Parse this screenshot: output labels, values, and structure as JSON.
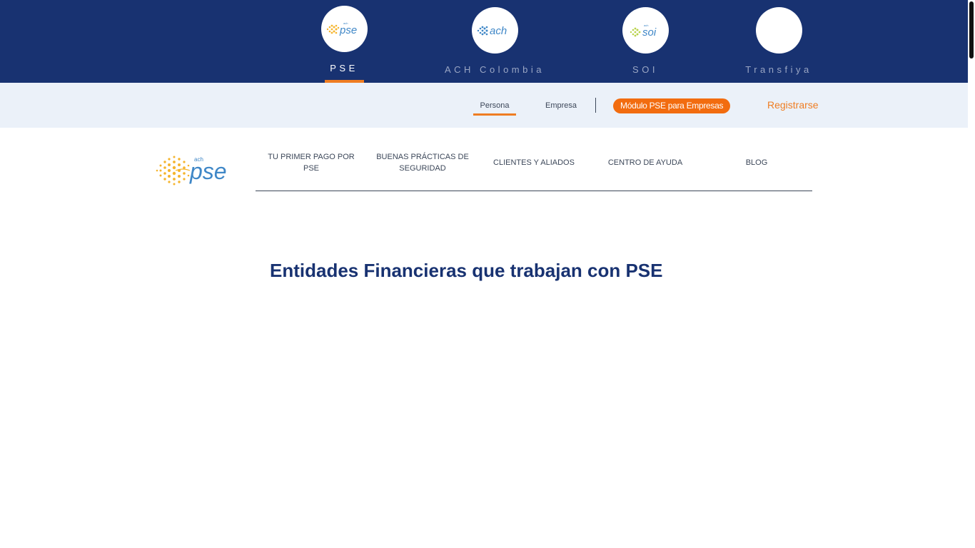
{
  "brands": [
    {
      "name": "PSE",
      "logo_text": "pse",
      "logo_sub": "ach",
      "active": true
    },
    {
      "name": "ACH Colombia",
      "logo_text": "ach",
      "active": false
    },
    {
      "name": "SOI",
      "logo_text": "soi",
      "logo_sub": "ach",
      "active": false
    },
    {
      "name": "Transfiya",
      "logo_text": "",
      "active": false
    }
  ],
  "subbar": {
    "tabs": [
      "Persona",
      "Empresa"
    ],
    "active_tab": "Persona",
    "cta_button": "Módulo PSE para Empresas",
    "register_link": "Registrarse"
  },
  "logo": {
    "text": "pse",
    "sub": "ach"
  },
  "nav": {
    "items": [
      "TU PRIMER PAGO POR PSE",
      "BUENAS PRÁCTICAS DE SEGURIDAD",
      "CLIENTES Y ALIADOS",
      "CENTRO DE AYUDA",
      "BLOG"
    ]
  },
  "page": {
    "title": "Entidades Financieras que trabajan con PSE"
  },
  "colors": {
    "brand_navy": "#183271",
    "accent_orange": "#ef7d22",
    "cta_orange": "#f26c0f",
    "subbar_bg": "#ebf1f9"
  }
}
